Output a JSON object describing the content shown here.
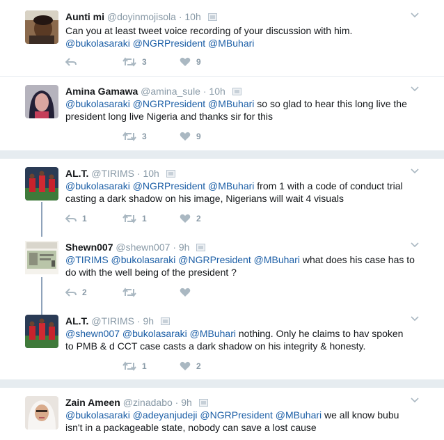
{
  "tweets": [
    {
      "name": "Aunti mi",
      "handle": "@doyinmojisola",
      "time": "· 10h",
      "text": [
        "Can you at least tweet voice recording of your discussion with him.",
        "@bukolasaraki @NGRPresident @MBuhari"
      ],
      "reply": "",
      "retweets": "3",
      "likes": "9"
    },
    {
      "name": "Amina Gamawa",
      "handle": "@amina_sule",
      "time": "· 10h",
      "text_mentions": "@bukolasaraki @NGRPresident @MBuhari",
      "text_rest": " so so glad to hear this long live the",
      "text_line2": "president long live Nigeria and thanks sir for this",
      "reply": "",
      "retweets": "3",
      "likes": "9"
    },
    {
      "name": "AL.T.",
      "handle": "@TIRIMS",
      "time": "· 10h",
      "text_mentions": "@bukolasaraki @NGRPresident @MBuhari",
      "text_rest": " from 1 with a code of conduct trial",
      "text_line2": "casting a dark shadow on his image, Nigerians will wait 4 visuals",
      "reply": "1",
      "retweets": "1",
      "likes": "2"
    },
    {
      "name": "Shewn007",
      "handle": "@shewn007",
      "time": "· 9h",
      "text_mentions": "@TIRIMS @bukolasaraki @NGRPresident @MBuhari",
      "text_rest": " what does his case has to",
      "text_line2": "do with the well being of the president ?",
      "reply": "2",
      "retweets": "",
      "likes": ""
    },
    {
      "name": "AL.T.",
      "handle": "@TIRIMS",
      "time": "· 9h",
      "text_mentions": "@shewn007 @bukolasaraki @MBuhari",
      "text_rest": " nothing. Only he claims to hav spoken",
      "text_line2": "to PMB & d CCT case casts a dark shadow on  his integrity & honesty.",
      "reply": "",
      "retweets": "1",
      "likes": "2"
    },
    {
      "name": "Zain Ameen",
      "handle": "@zinadabo",
      "time": "· 9h",
      "text_mentions": "@bukolasaraki @adeyanjudeji @NGRPresident @MBuhari",
      "text_rest": " we all know bubu",
      "text_line2": "isn't in a packageable state, nobody can save a lost cause",
      "reply": "",
      "retweets": "",
      "likes": ""
    }
  ],
  "colors": {
    "mention": "#1b5ea6",
    "muted": "#8899a6",
    "background": "#e6ecf0",
    "thread_line": "#8ea2ba"
  },
  "icons": [
    "reply-icon",
    "retweet-icon",
    "like-icon",
    "caret-down-icon",
    "verified-badge-icon"
  ]
}
